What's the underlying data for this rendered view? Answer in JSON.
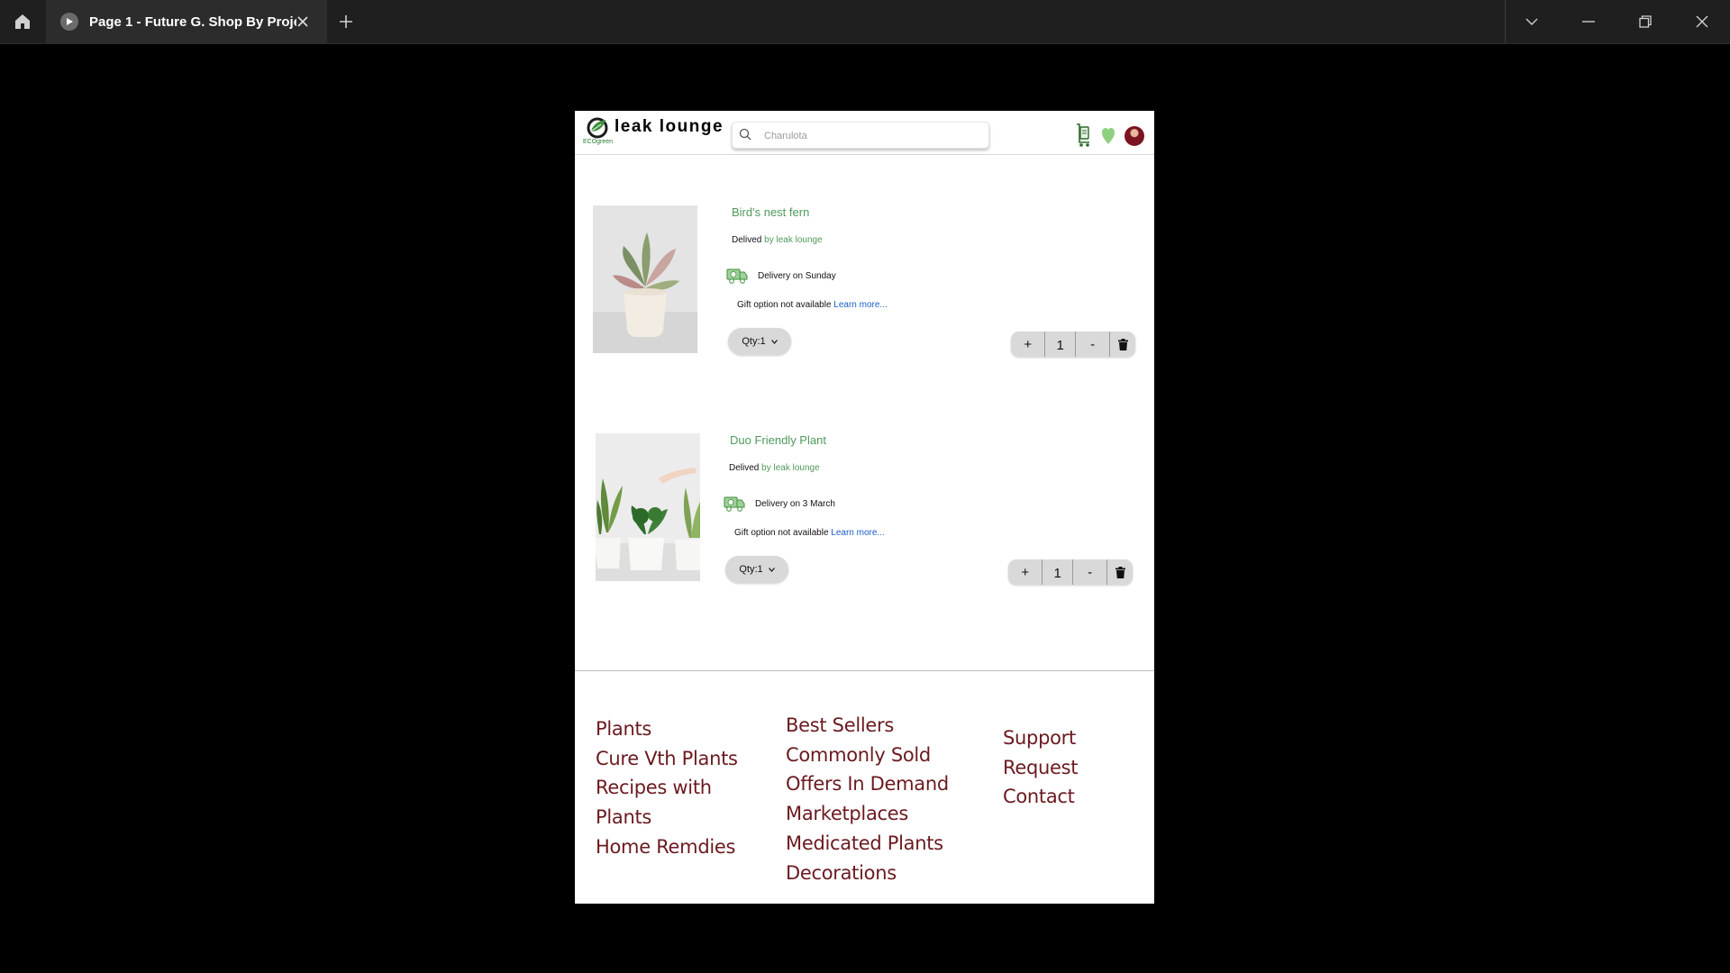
{
  "window": {
    "tab_title": "Page 1 - Future G. Shop By Project",
    "icons": [
      "home-icon",
      "play-icon",
      "close-icon",
      "plus-icon",
      "chevron-down-icon",
      "minimize-icon",
      "restore-icon",
      "close-icon"
    ]
  },
  "header": {
    "logo_subtext": "ECOgreen",
    "brand": "leak lounge",
    "search_placeholder": "Charulota",
    "icons": [
      "cart-icon",
      "heart-icon",
      "avatar"
    ]
  },
  "products": [
    {
      "name": "Bird's nest fern",
      "delivered_prefix": "Delived ",
      "seller": "by leak lounge",
      "delivery": "Delivery on Sunday",
      "gift": "Gift option not available ",
      "learn_more": "Learn more...",
      "qty_label": "Qty:1",
      "qty_value": "1",
      "plus": "+",
      "minus": "-"
    },
    {
      "name": "Duo Friendly Plant",
      "delivered_prefix": "Delived ",
      "seller": "by leak lounge",
      "delivery": "Delivery on 3 March",
      "gift": "Gift option not available ",
      "learn_more": "Learn more...",
      "qty_label": "Qty:1",
      "qty_value": "1",
      "plus": "+",
      "minus": "-"
    }
  ],
  "footer": {
    "col1": [
      "Plants",
      "Cure Vth Plants",
      "Recipes with",
      "Plants",
      "Home Remdies"
    ],
    "col2": [
      "Best Sellers",
      "Commonly Sold",
      "Offers In Demand",
      "Marketplaces",
      "Medicated Plants",
      "Decorations"
    ],
    "col3": [
      "Support",
      "Request",
      "Contact"
    ]
  },
  "colors": {
    "accent_green": "#4f9a5b",
    "link_blue": "#1a5fc8",
    "footer_text": "#6b1a1f",
    "titlebar": "#1f1f1f"
  }
}
